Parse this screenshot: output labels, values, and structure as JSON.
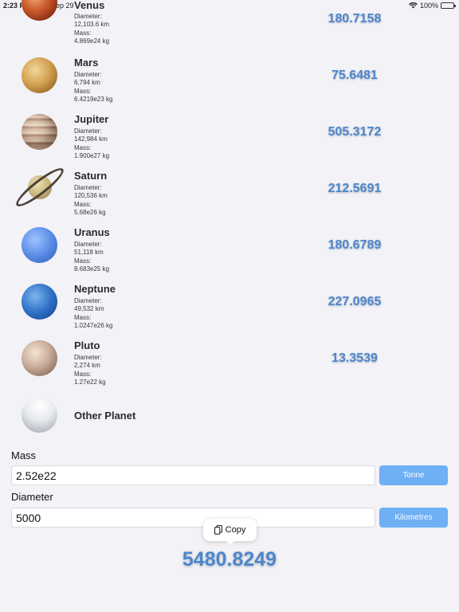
{
  "status_bar": {
    "time": "2:23 PM",
    "date": "Thu Sep 29",
    "battery": "100%",
    "battery_level": 1.0
  },
  "planets": [
    {
      "name": "Venus",
      "diameter_label": "Diameter:",
      "diameter": "12,103.6 km",
      "mass_label": "Mass:",
      "mass": "4.869e24 kg",
      "value": "180.7158",
      "icon": "venus-icon"
    },
    {
      "name": "Mars",
      "diameter_label": "Diameter:",
      "diameter": "6,794 km",
      "mass_label": "Mass:",
      "mass": "6.4219e23 kg",
      "value": "75.6481",
      "icon": "mars-icon"
    },
    {
      "name": "Jupiter",
      "diameter_label": "Diameter:",
      "diameter": "142,984 km",
      "mass_label": "Mass:",
      "mass": "1.900e27 kg",
      "value": "505.3172",
      "icon": "jupiter-icon"
    },
    {
      "name": "Saturn",
      "diameter_label": "Diameter:",
      "diameter": "120,536 km",
      "mass_label": "Mass:",
      "mass": "5.68e26 kg",
      "value": "212.5691",
      "icon": "saturn-icon"
    },
    {
      "name": "Uranus",
      "diameter_label": "Diameter:",
      "diameter": "51,118 km",
      "mass_label": "Mass:",
      "mass": "8.683e25 kg",
      "value": "180.6789",
      "icon": "uranus-icon"
    },
    {
      "name": "Neptune",
      "diameter_label": "Diameter:",
      "diameter": "49,532 km",
      "mass_label": "Mass:",
      "mass": "1.0247e26 kg",
      "value": "227.0965",
      "icon": "neptune-icon"
    },
    {
      "name": "Pluto",
      "diameter_label": "Diameter:",
      "diameter": "2,274 km",
      "mass_label": "Mass:",
      "mass": "1.27e22 kg",
      "value": "13.3539",
      "icon": "pluto-icon"
    }
  ],
  "other_planet": {
    "name": "Other Planet",
    "icon": "other-planet-icon"
  },
  "inputs": {
    "mass_label": "Mass",
    "mass_value": "2.52e22",
    "mass_unit": "Tonne",
    "diameter_label": "Diameter",
    "diameter_value": "5000",
    "diameter_unit": "Kilometres"
  },
  "copy_menu": {
    "label": "Copy",
    "icon": "copy-icon"
  },
  "result": "5480.8249",
  "colors": {
    "accent_text": "#4e86c9",
    "unit_button": "#6fb0f5",
    "background": "#f2f2f7"
  }
}
